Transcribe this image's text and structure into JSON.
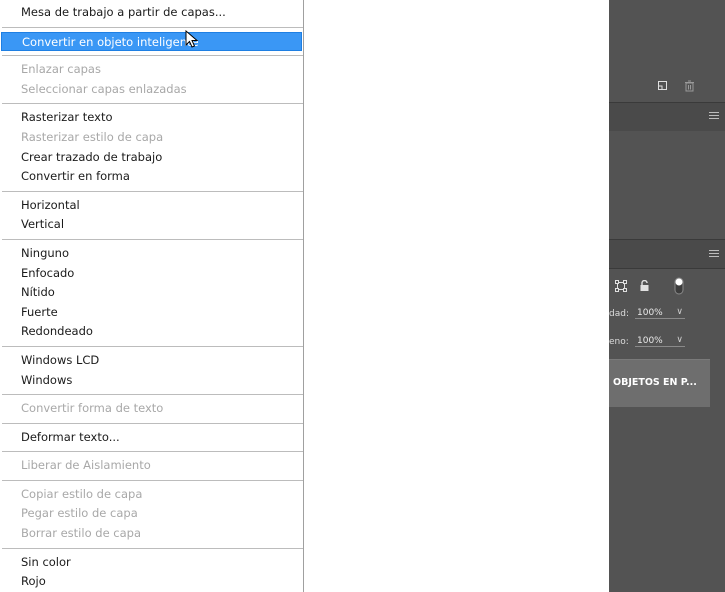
{
  "menu": {
    "groups": [
      [
        {
          "label": "Mesa de trabajo a partir de capas...",
          "enabled": true
        }
      ],
      [
        {
          "label": "Convertir en objeto inteligente",
          "enabled": true,
          "highlighted": true
        }
      ],
      [
        {
          "label": "Enlazar capas",
          "enabled": false
        },
        {
          "label": "Seleccionar capas enlazadas",
          "enabled": false
        }
      ],
      [
        {
          "label": "Rasterizar texto",
          "enabled": true
        },
        {
          "label": "Rasterizar estilo de capa",
          "enabled": false
        },
        {
          "label": "Crear trazado de trabajo",
          "enabled": true
        },
        {
          "label": "Convertir en forma",
          "enabled": true
        }
      ],
      [
        {
          "label": "Horizontal",
          "enabled": true
        },
        {
          "label": "Vertical",
          "enabled": true
        }
      ],
      [
        {
          "label": "Ninguno",
          "enabled": true
        },
        {
          "label": "Enfocado",
          "enabled": true
        },
        {
          "label": "Nítido",
          "enabled": true
        },
        {
          "label": "Fuerte",
          "enabled": true
        },
        {
          "label": "Redondeado",
          "enabled": true
        }
      ],
      [
        {
          "label": "Windows LCD",
          "enabled": true
        },
        {
          "label": "Windows",
          "enabled": true
        }
      ],
      [
        {
          "label": "Convertir forma de texto",
          "enabled": false
        }
      ],
      [
        {
          "label": "Deformar texto...",
          "enabled": true
        }
      ],
      [
        {
          "label": "Liberar de Aislamiento",
          "enabled": false
        }
      ],
      [
        {
          "label": "Copiar estilo de capa",
          "enabled": false
        },
        {
          "label": "Pegar estilo de capa",
          "enabled": false
        },
        {
          "label": "Borrar estilo de capa",
          "enabled": false
        }
      ],
      [
        {
          "label": "Sin color",
          "enabled": true
        },
        {
          "label": "Rojo",
          "enabled": true
        }
      ]
    ]
  },
  "layers_panel": {
    "opacity_label": "dad:",
    "opacity_value": "100%",
    "fill_label": "eno:",
    "fill_value": "100%",
    "layer_name": "OBJETOS EN P..."
  },
  "colors": {
    "highlight": "#3a97f5",
    "panel_bg": "#535353"
  }
}
